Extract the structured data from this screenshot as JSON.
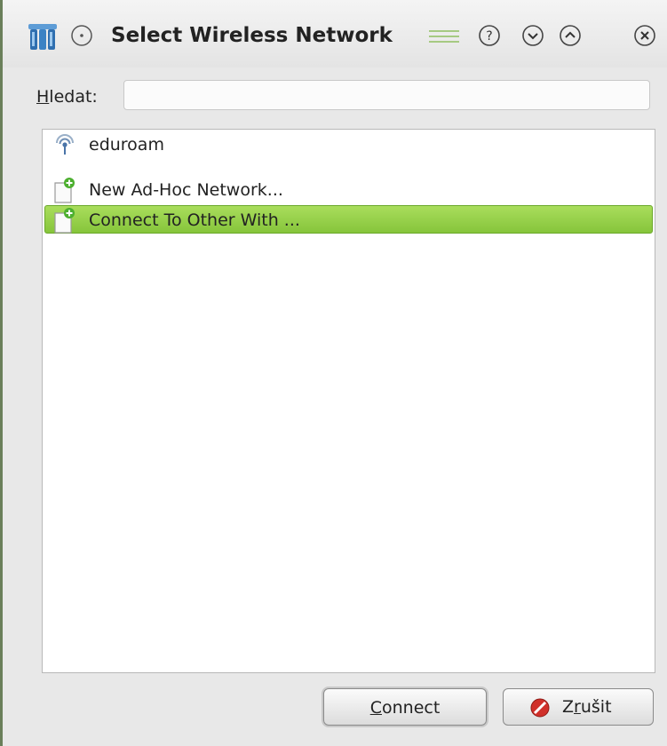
{
  "window": {
    "title": "Select Wireless Network"
  },
  "search": {
    "label_accel": "H",
    "label_rest": "ledat:",
    "value": "",
    "placeholder": ""
  },
  "networks": [
    {
      "name": "eduroam",
      "icon": "wifi-signal-icon",
      "selected": false
    },
    {
      "name": "New Ad-Hoc Network...",
      "icon": "new-document-add-icon",
      "selected": false
    },
    {
      "name": "Connect To Other With ...",
      "icon": "new-document-add-icon",
      "selected": true
    }
  ],
  "buttons": {
    "connect_accel": "C",
    "connect_rest": "onnect",
    "cancel_pre": "Z",
    "cancel_accel": "r",
    "cancel_rest": "ušit"
  },
  "colors": {
    "selection": "#93cf45",
    "selection_border": "#6aa82a",
    "app_icon": "#2f6fb0",
    "cancel_icon": "#d0302a"
  }
}
